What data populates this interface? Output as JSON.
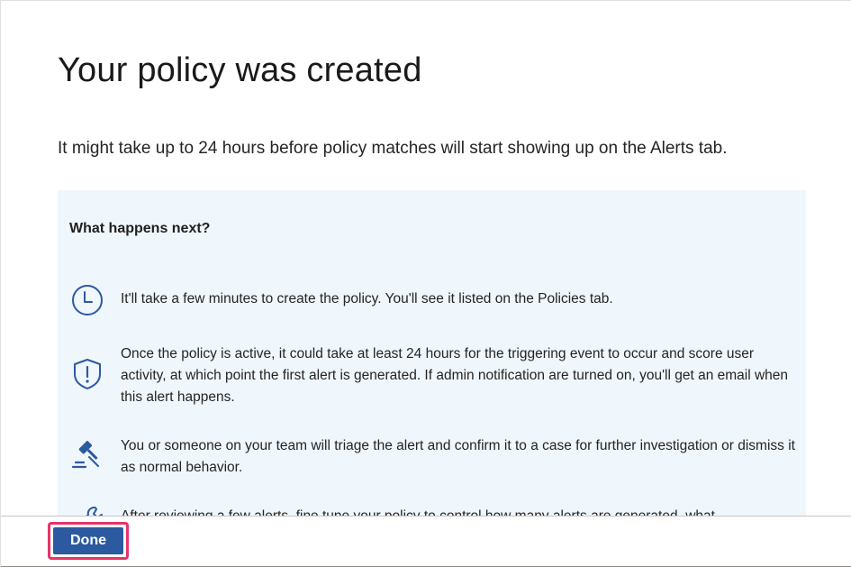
{
  "page": {
    "title": "Your policy was created",
    "subtitle": "It might take up to 24 hours before policy matches will start showing up on the Alerts tab."
  },
  "next_steps": {
    "heading": "What happens next?",
    "items": [
      {
        "icon": "clock-icon",
        "text": "It'll take a few minutes to create the policy. You'll see it listed on the Policies tab."
      },
      {
        "icon": "shield-alert-icon",
        "text": "Once the policy is active, it could take at least 24 hours for the triggering event to occur and score user activity, at which point the first alert is generated. If admin notification are turned on, you'll get an email when this alert happens."
      },
      {
        "icon": "gavel-icon",
        "text": "You or someone on your team will triage the alert and confirm it to a case for further investigation or dismiss it as normal behavior."
      },
      {
        "icon": "wrench-icon",
        "text": "After reviewing a few alerts, fine tune your policy to control how many alerts are generated, what"
      }
    ]
  },
  "footer": {
    "done_label": "Done"
  },
  "colors": {
    "icon_blue": "#2c5aa0",
    "panel_background": "#eff6fc",
    "button_background": "#2c5aa0",
    "highlight_border": "#e8336a"
  }
}
